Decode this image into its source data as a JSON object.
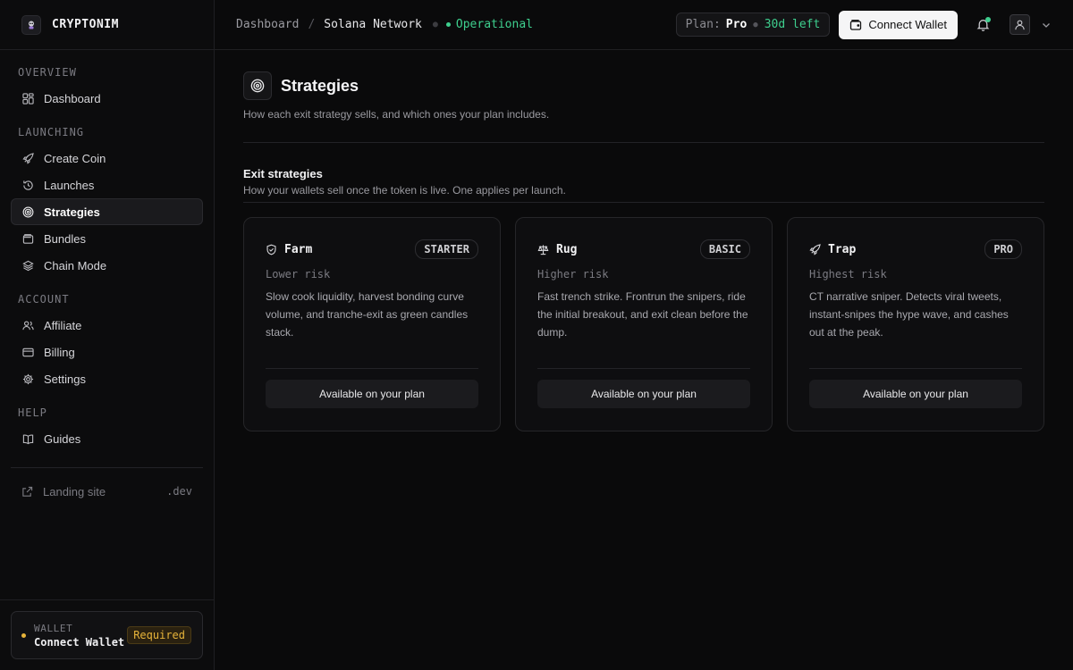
{
  "brand": {
    "name": "CRYPTONIM"
  },
  "sidebar": {
    "sections": {
      "overview": "OVERVIEW",
      "launching": "LAUNCHING",
      "account": "ACCOUNT",
      "help": "HELP"
    },
    "items": {
      "dashboard": "Dashboard",
      "create_coin": "Create Coin",
      "launches": "Launches",
      "strategies": "Strategies",
      "bundles": "Bundles",
      "chain_mode": "Chain Mode",
      "affiliate": "Affiliate",
      "billing": "Billing",
      "settings": "Settings",
      "guides": "Guides"
    },
    "active": "strategies",
    "landing": {
      "label": "Landing site",
      "suffix": ".dev"
    },
    "wallet": {
      "label": "WALLET",
      "value": "Connect Wallet",
      "badge": "Required"
    }
  },
  "header": {
    "breadcrumb": [
      "Dashboard",
      "Solana Network"
    ],
    "separator": "/",
    "status": "Operational",
    "plan": {
      "key": "Plan:",
      "value": "Pro",
      "remaining": "30d left"
    },
    "connect_label": "Connect Wallet"
  },
  "page": {
    "title": "Strategies",
    "subtitle": "How each exit strategy sells, and which ones your plan includes.",
    "section_title": "Exit strategies",
    "section_subtitle": "How your wallets sell once the token is live. One applies per launch."
  },
  "strategies": [
    {
      "name": "Farm",
      "icon": "shield-icon",
      "tier": "STARTER",
      "risk": "Lower risk",
      "description": "Slow cook liquidity, harvest bonding curve volume, and tranche-exit as green candles stack.",
      "action": "Available on your plan"
    },
    {
      "name": "Rug",
      "icon": "scale-icon",
      "tier": "BASIC",
      "risk": "Higher risk",
      "description": "Fast trench strike. Frontrun the snipers, ride the initial breakout, and exit clean before the dump.",
      "action": "Available on your plan"
    },
    {
      "name": "Trap",
      "icon": "rocket-icon",
      "tier": "PRO",
      "risk": "Highest risk",
      "description": "CT narrative sniper. Detects viral tweets, instant-snipes the hype wave, and cashes out at the peak.",
      "action": "Available on your plan"
    }
  ],
  "colors": {
    "accent_green": "#3ecf8e",
    "warning": "#e7b43a",
    "background": "#0a0a0b"
  }
}
